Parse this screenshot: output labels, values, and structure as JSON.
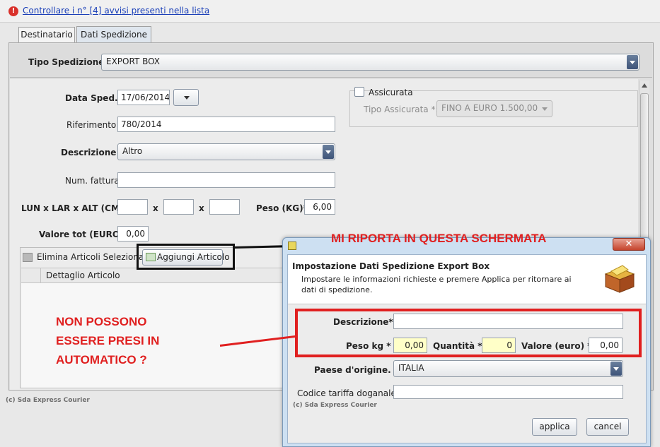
{
  "notice": {
    "text": "Controllare i n° [4] avvisi presenti nella lista"
  },
  "tabs": [
    {
      "label": "Destinatario"
    },
    {
      "label": "Dati Spedizione"
    }
  ],
  "shipment_type": {
    "label": "Tipo Spedizione :",
    "value": "EXPORT BOX"
  },
  "form": {
    "date_label": "Data Sped. *:",
    "date_value": "17/06/2014",
    "reference_label": "Riferimento :",
    "reference_value": "780/2014",
    "description_label": "Descrizione *:",
    "description_value": "Altro",
    "invoice_label": "Num. fattura :",
    "invoice_value": "",
    "dims_label": "LUN x LAR x ALT (CM) *:",
    "dims_sep": "x",
    "weight_label": "Peso (KG)* :",
    "weight_value": "6,00",
    "total_value_label": "Valore tot (EURO) *:",
    "total_value_value": "0,00"
  },
  "insurance": {
    "checkbox_label": "Assicurata",
    "type_label": "Tipo Assicurata *:",
    "type_value": "FINO A EURO 1.500,00"
  },
  "articles": {
    "delete_label": "Elimina Articoli Selezionati",
    "add_label": "Aggiungi Articolo",
    "column_header": "Dettaglio Articolo"
  },
  "footer": {
    "copyright": "(c) Sda Express Courier"
  },
  "dialog": {
    "title": "Impostazione Dati Spedizione Export Box",
    "subtitle": "Impostare le informazioni richieste e premere Applica per ritornare ai dati di spedizione.",
    "description_label": "Descrizione* :",
    "description_value": "",
    "weight_label": "Peso kg * :",
    "weight_value": "0,00",
    "quantity_label": "Quantità * :",
    "quantity_value": "0",
    "value_label": "Valore (euro) * :",
    "value_value": "0,00",
    "origin_label": "Paese d'origine. * :",
    "origin_value": "ITALIA",
    "tariff_label": "Codice tariffa doganale :",
    "tariff_value": "",
    "copyright": "(c) Sda Express Courier",
    "apply_label": "applica",
    "cancel_label": "cancel"
  },
  "annotations": {
    "top": "MI RIPORTA IN QUESTA SCHERMATA",
    "left_lines": [
      "NON POSSONO",
      "ESSERE PRESI IN",
      "AUTOMATICO ?"
    ],
    "color": "#e02020"
  }
}
